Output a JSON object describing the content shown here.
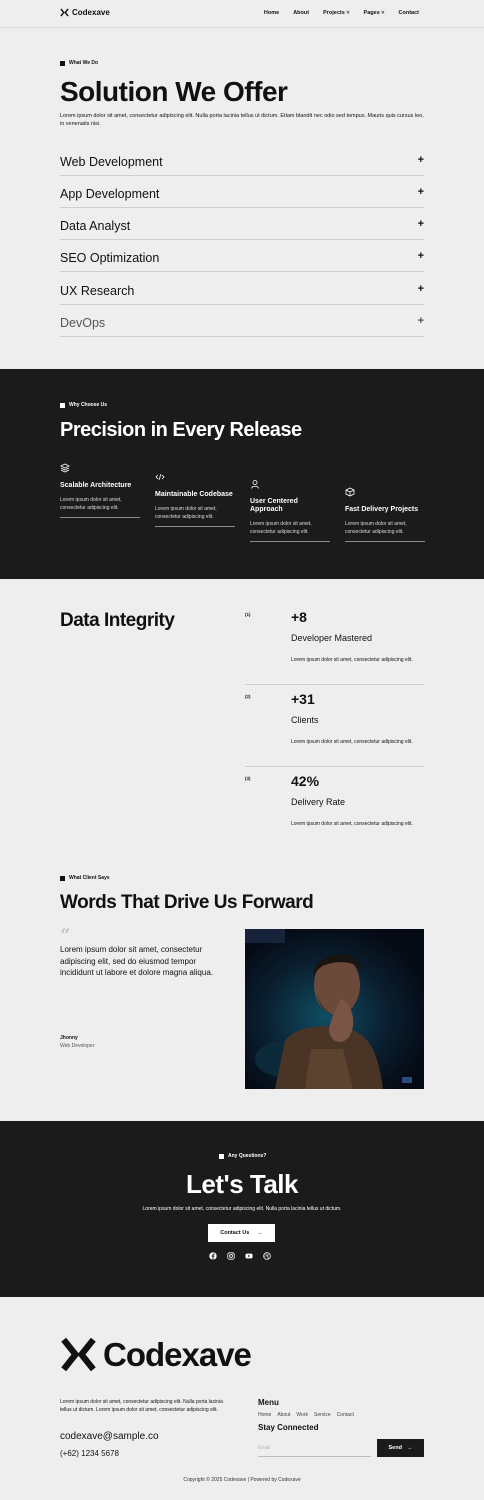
{
  "nav": {
    "brand": "Codexave",
    "links": [
      "Home",
      "About",
      "Projects",
      "Pages",
      "Contact"
    ]
  },
  "services": {
    "eyebrow": "What We Do",
    "title": "Solution We Offer",
    "description": "Lorem ipsum dolor sit amet, consectetur adipiscing elit. Nulla porta lacinia tellus ut dictum. Etiam blandit nec odio sed tempus. Mauris quis cursus leo, in venenatis nisi.",
    "items": [
      "Web Development",
      "App Development",
      "Data Analyst",
      "SEO Optimization",
      "UX Research",
      "DevOps"
    ],
    "expand_glyph": "+"
  },
  "why": {
    "eyebrow": "Why Choose Us",
    "title": "Precision in Every Release",
    "features": [
      {
        "icon": "layers-icon",
        "title": "Scalable Architecture",
        "desc": "Lorem ipsum dolor sit amet, consectetur adipiscing elit."
      },
      {
        "icon": "code-icon",
        "title": "Maintainable Codebase",
        "desc": "Lorem ipsum dolor sit amet, consectetur adipiscing elit."
      },
      {
        "icon": "user-icon",
        "title": "User Centered Approach",
        "desc": "Lorem ipsum dolor sit amet, consectetur adipiscing elit."
      },
      {
        "icon": "box-icon",
        "title": "Fast Delivery Projects",
        "desc": "Lorem ipsum dolor sit amet, consectetur adipiscing elit."
      }
    ]
  },
  "integrity": {
    "title": "Data Integrity",
    "stats": [
      {
        "num": "(1)",
        "value": "+8",
        "caption": "Developer Mastered",
        "desc": "Lorem ipsum dolor sit amet, consectetur adipiscing elit."
      },
      {
        "num": "(2)",
        "value": "+31",
        "caption": "Clients",
        "desc": "Lorem ipsum dolor sit amet, consectetur adipiscing elit."
      },
      {
        "num": "(3)",
        "value": "42%",
        "caption": "Delivery Rate",
        "desc": "Lorem ipsum dolor sit amet, consectetur adipiscing elit."
      }
    ]
  },
  "testimonial": {
    "eyebrow": "What Client Says",
    "title": "Words That Drive Us Forward",
    "quote": "Lorem ipsum dolor sit amet, consectetur adipiscing elit, sed do eiusmod tempor incididunt ut labore et dolore magna aliqua.",
    "author": "Jhonny",
    "role": "Web Developer"
  },
  "cta": {
    "eyebrow": "Any Questions?",
    "title": "Let's Talk",
    "description": "Lorem ipsum dolor sit amet, consectetur adipiscing elit. Nulla porta lacinia tellus ut dictum.",
    "button": "Contact Us",
    "socials": [
      "facebook-icon",
      "instagram-icon",
      "youtube-icon",
      "dribbble-icon"
    ]
  },
  "footer": {
    "brand": "Codexave",
    "description": "Lorem ipsum dolor sit amet, consectetur adipiscing elit. Nulla porta lacinia tellus ut dictum. Lorem ipsum dolor sit amet, consectetur adipiscing elit.",
    "email": "codexave@sample.co",
    "phone": "(+62) 1234 5678",
    "menu_title": "Menu",
    "menu": [
      "Home",
      "About",
      "Work",
      "Service",
      "Contact"
    ],
    "stay_title": "Stay Connected",
    "email_placeholder": "Email",
    "send": "Send",
    "copyright": "Copyright © 2025 Codexave | Powered by Codexave"
  }
}
